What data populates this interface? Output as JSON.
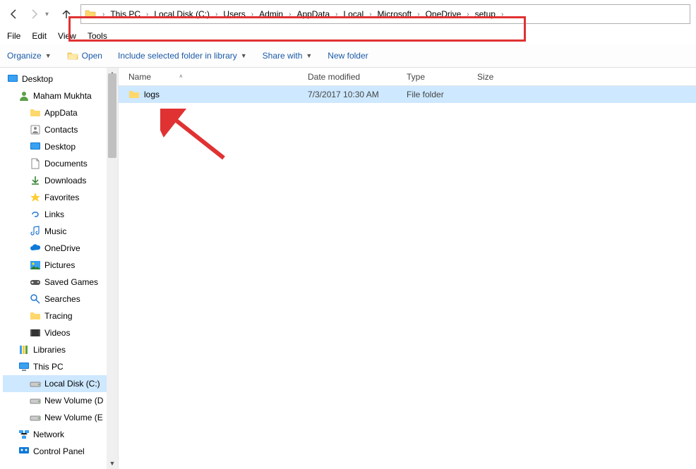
{
  "nav": {
    "back": "←",
    "forward": "→",
    "up": "↑"
  },
  "breadcrumb": [
    "This PC",
    "Local Disk (C:)",
    "Users",
    "Admin",
    "AppData",
    "Local",
    "Microsoft",
    "OneDrive",
    "setup"
  ],
  "menubar": {
    "file": "File",
    "edit": "Edit",
    "view": "View",
    "tools": "Tools"
  },
  "toolbar": {
    "organize": "Organize",
    "open": "Open",
    "include": "Include selected folder in library",
    "share": "Share with",
    "newfolder": "New folder"
  },
  "columns": {
    "name": "Name",
    "date": "Date modified",
    "type": "Type",
    "size": "Size"
  },
  "rows": [
    {
      "name": "logs",
      "date": "7/3/2017 10:30 AM",
      "type": "File folder",
      "size": ""
    }
  ],
  "tree": {
    "desktop": "Desktop",
    "user": "Maham Mukhta",
    "appdata": "AppData",
    "contacts": "Contacts",
    "desktop2": "Desktop",
    "documents": "Documents",
    "downloads": "Downloads",
    "favorites": "Favorites",
    "links": "Links",
    "music": "Music",
    "onedrive": "OneDrive",
    "pictures": "Pictures",
    "savedgames": "Saved Games",
    "searches": "Searches",
    "tracing": "Tracing",
    "videos": "Videos",
    "libraries": "Libraries",
    "thispc": "This PC",
    "localdisk": "Local Disk (C:)",
    "newvol1": "New Volume (D",
    "newvol2": "New Volume (E",
    "network": "Network",
    "controlpanel": "Control Panel"
  }
}
